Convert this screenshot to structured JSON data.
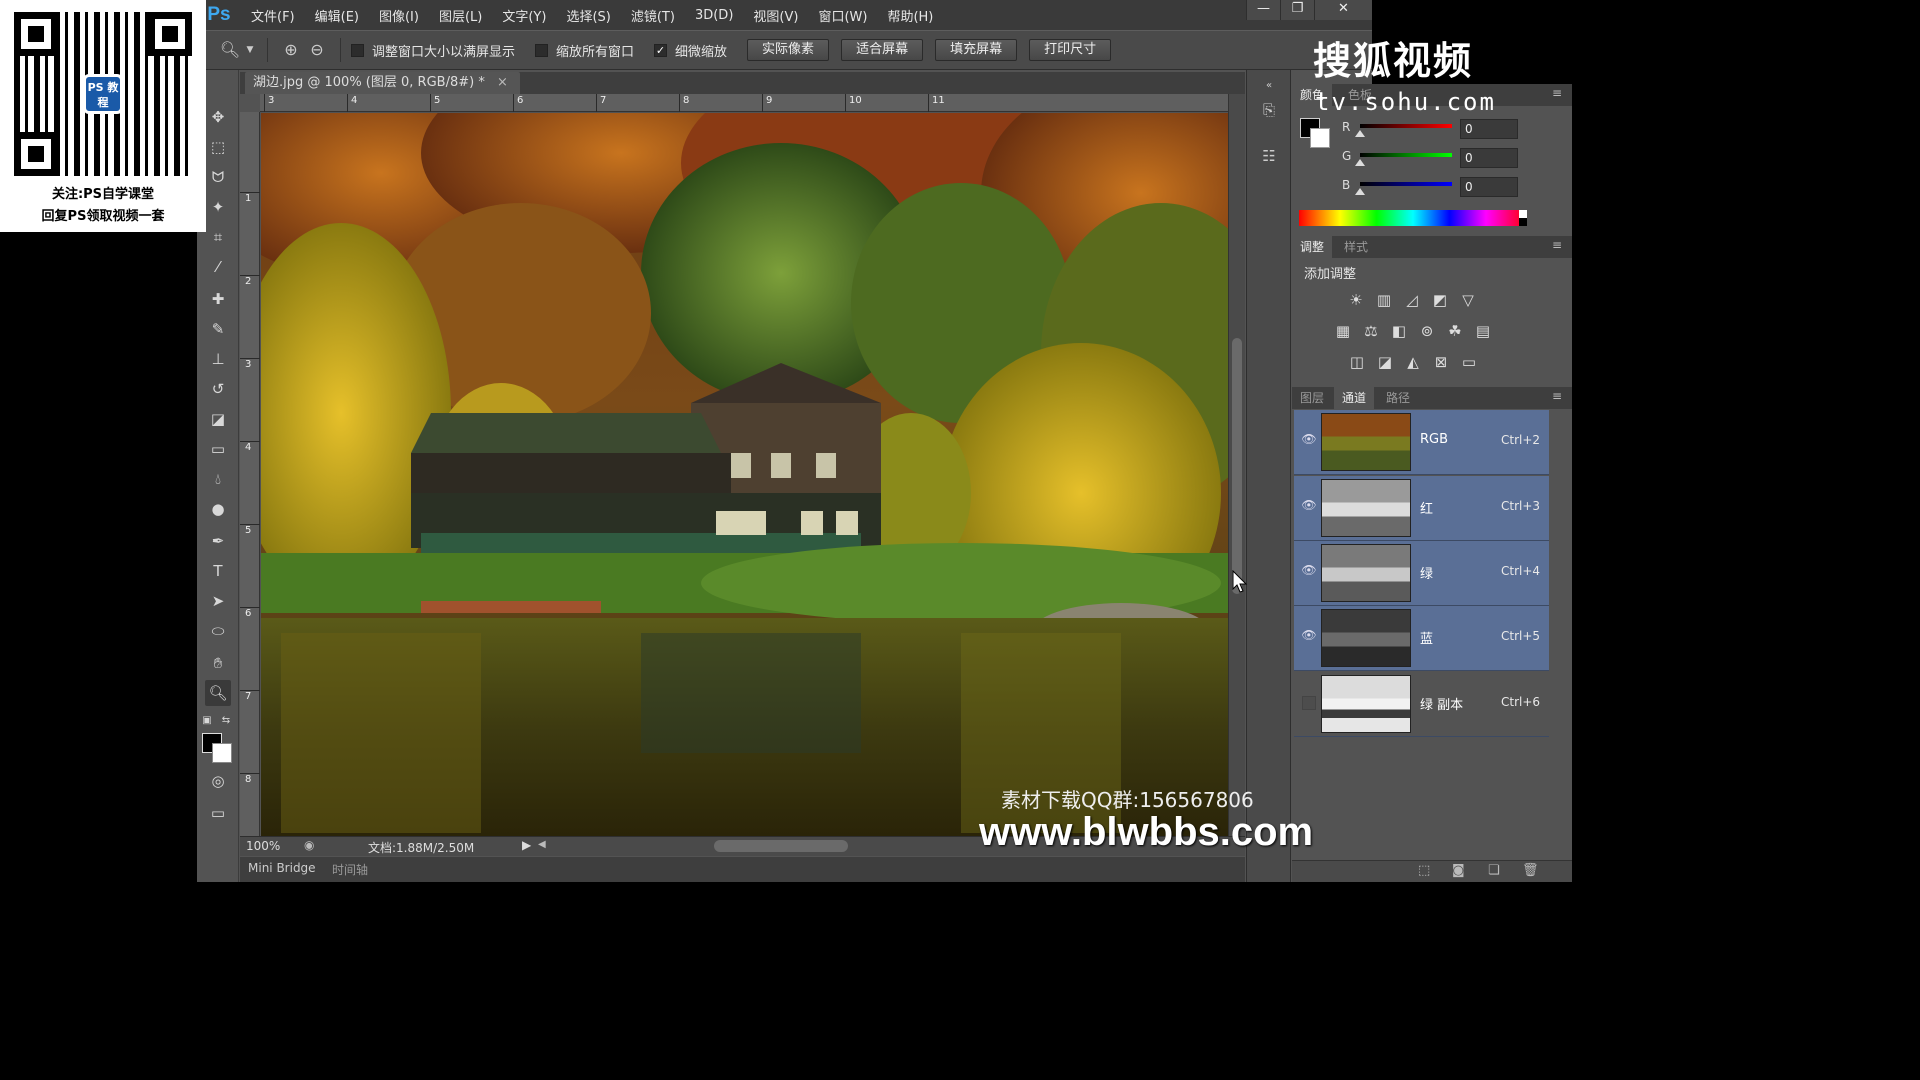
{
  "qr_overlay": {
    "logo_text": "PS 教程",
    "line1": "关注:PS自学课堂",
    "line2": "回复PS领取视频一套"
  },
  "app": {
    "logo": "Ps",
    "menu": [
      "文件(F)",
      "编辑(E)",
      "图像(I)",
      "图层(L)",
      "文字(Y)",
      "选择(S)",
      "滤镜(T)",
      "3D(D)",
      "视图(V)",
      "窗口(W)",
      "帮助(H)"
    ],
    "window_controls": {
      "minimize": "—",
      "restore": "❐",
      "close": "✕"
    }
  },
  "options_bar": {
    "checkboxes": [
      {
        "label": "调整窗口大小以满屏显示",
        "checked": false
      },
      {
        "label": "缩放所有窗口",
        "checked": false
      },
      {
        "label": "细微缩放",
        "checked": true
      }
    ],
    "buttons": [
      "实际像素",
      "适合屏幕",
      "填充屏幕",
      "打印尺寸"
    ]
  },
  "document": {
    "tab_title": "湖边.jpg @ 100% (图层 0, RGB/8#) *",
    "tab_close": "×",
    "ruler_h": [
      "3",
      "4",
      "5",
      "6",
      "7",
      "8",
      "9",
      "10",
      "11"
    ],
    "ruler_v": [
      "1",
      "2",
      "3",
      "4",
      "5",
      "6",
      "7",
      "8"
    ],
    "zoom": "100%",
    "doc_info": "文档:1.88M/2.50M"
  },
  "bottom_tabs": [
    "Mini Bridge",
    "时间轴"
  ],
  "color_panel": {
    "tabs": [
      "颜色",
      "色板"
    ],
    "channels": [
      {
        "label": "R",
        "value": "0"
      },
      {
        "label": "G",
        "value": "0"
      },
      {
        "label": "B",
        "value": "0"
      }
    ]
  },
  "adjust_panel": {
    "tabs": [
      "调整",
      "样式"
    ],
    "title": "添加调整"
  },
  "channels_panel": {
    "tabs": [
      "图层",
      "通道",
      "路径"
    ],
    "channels": [
      {
        "name": "RGB",
        "shortcut": "Ctrl+2",
        "visible": true
      },
      {
        "name": "红",
        "shortcut": "Ctrl+3",
        "visible": true
      },
      {
        "name": "绿",
        "shortcut": "Ctrl+4",
        "visible": true
      },
      {
        "name": "蓝",
        "shortcut": "Ctrl+5",
        "visible": true
      },
      {
        "name": "绿 副本",
        "shortcut": "Ctrl+6",
        "visible": false
      }
    ]
  },
  "watermarks": {
    "sohu": "搜狐视频",
    "sohu_url": "tv.sohu.com",
    "qq": "素材下载QQ群:156567806",
    "site": "www.blwbbs.com"
  },
  "colors": {
    "channel_selected": "#5a6f96",
    "panel_bg": "#535353"
  }
}
